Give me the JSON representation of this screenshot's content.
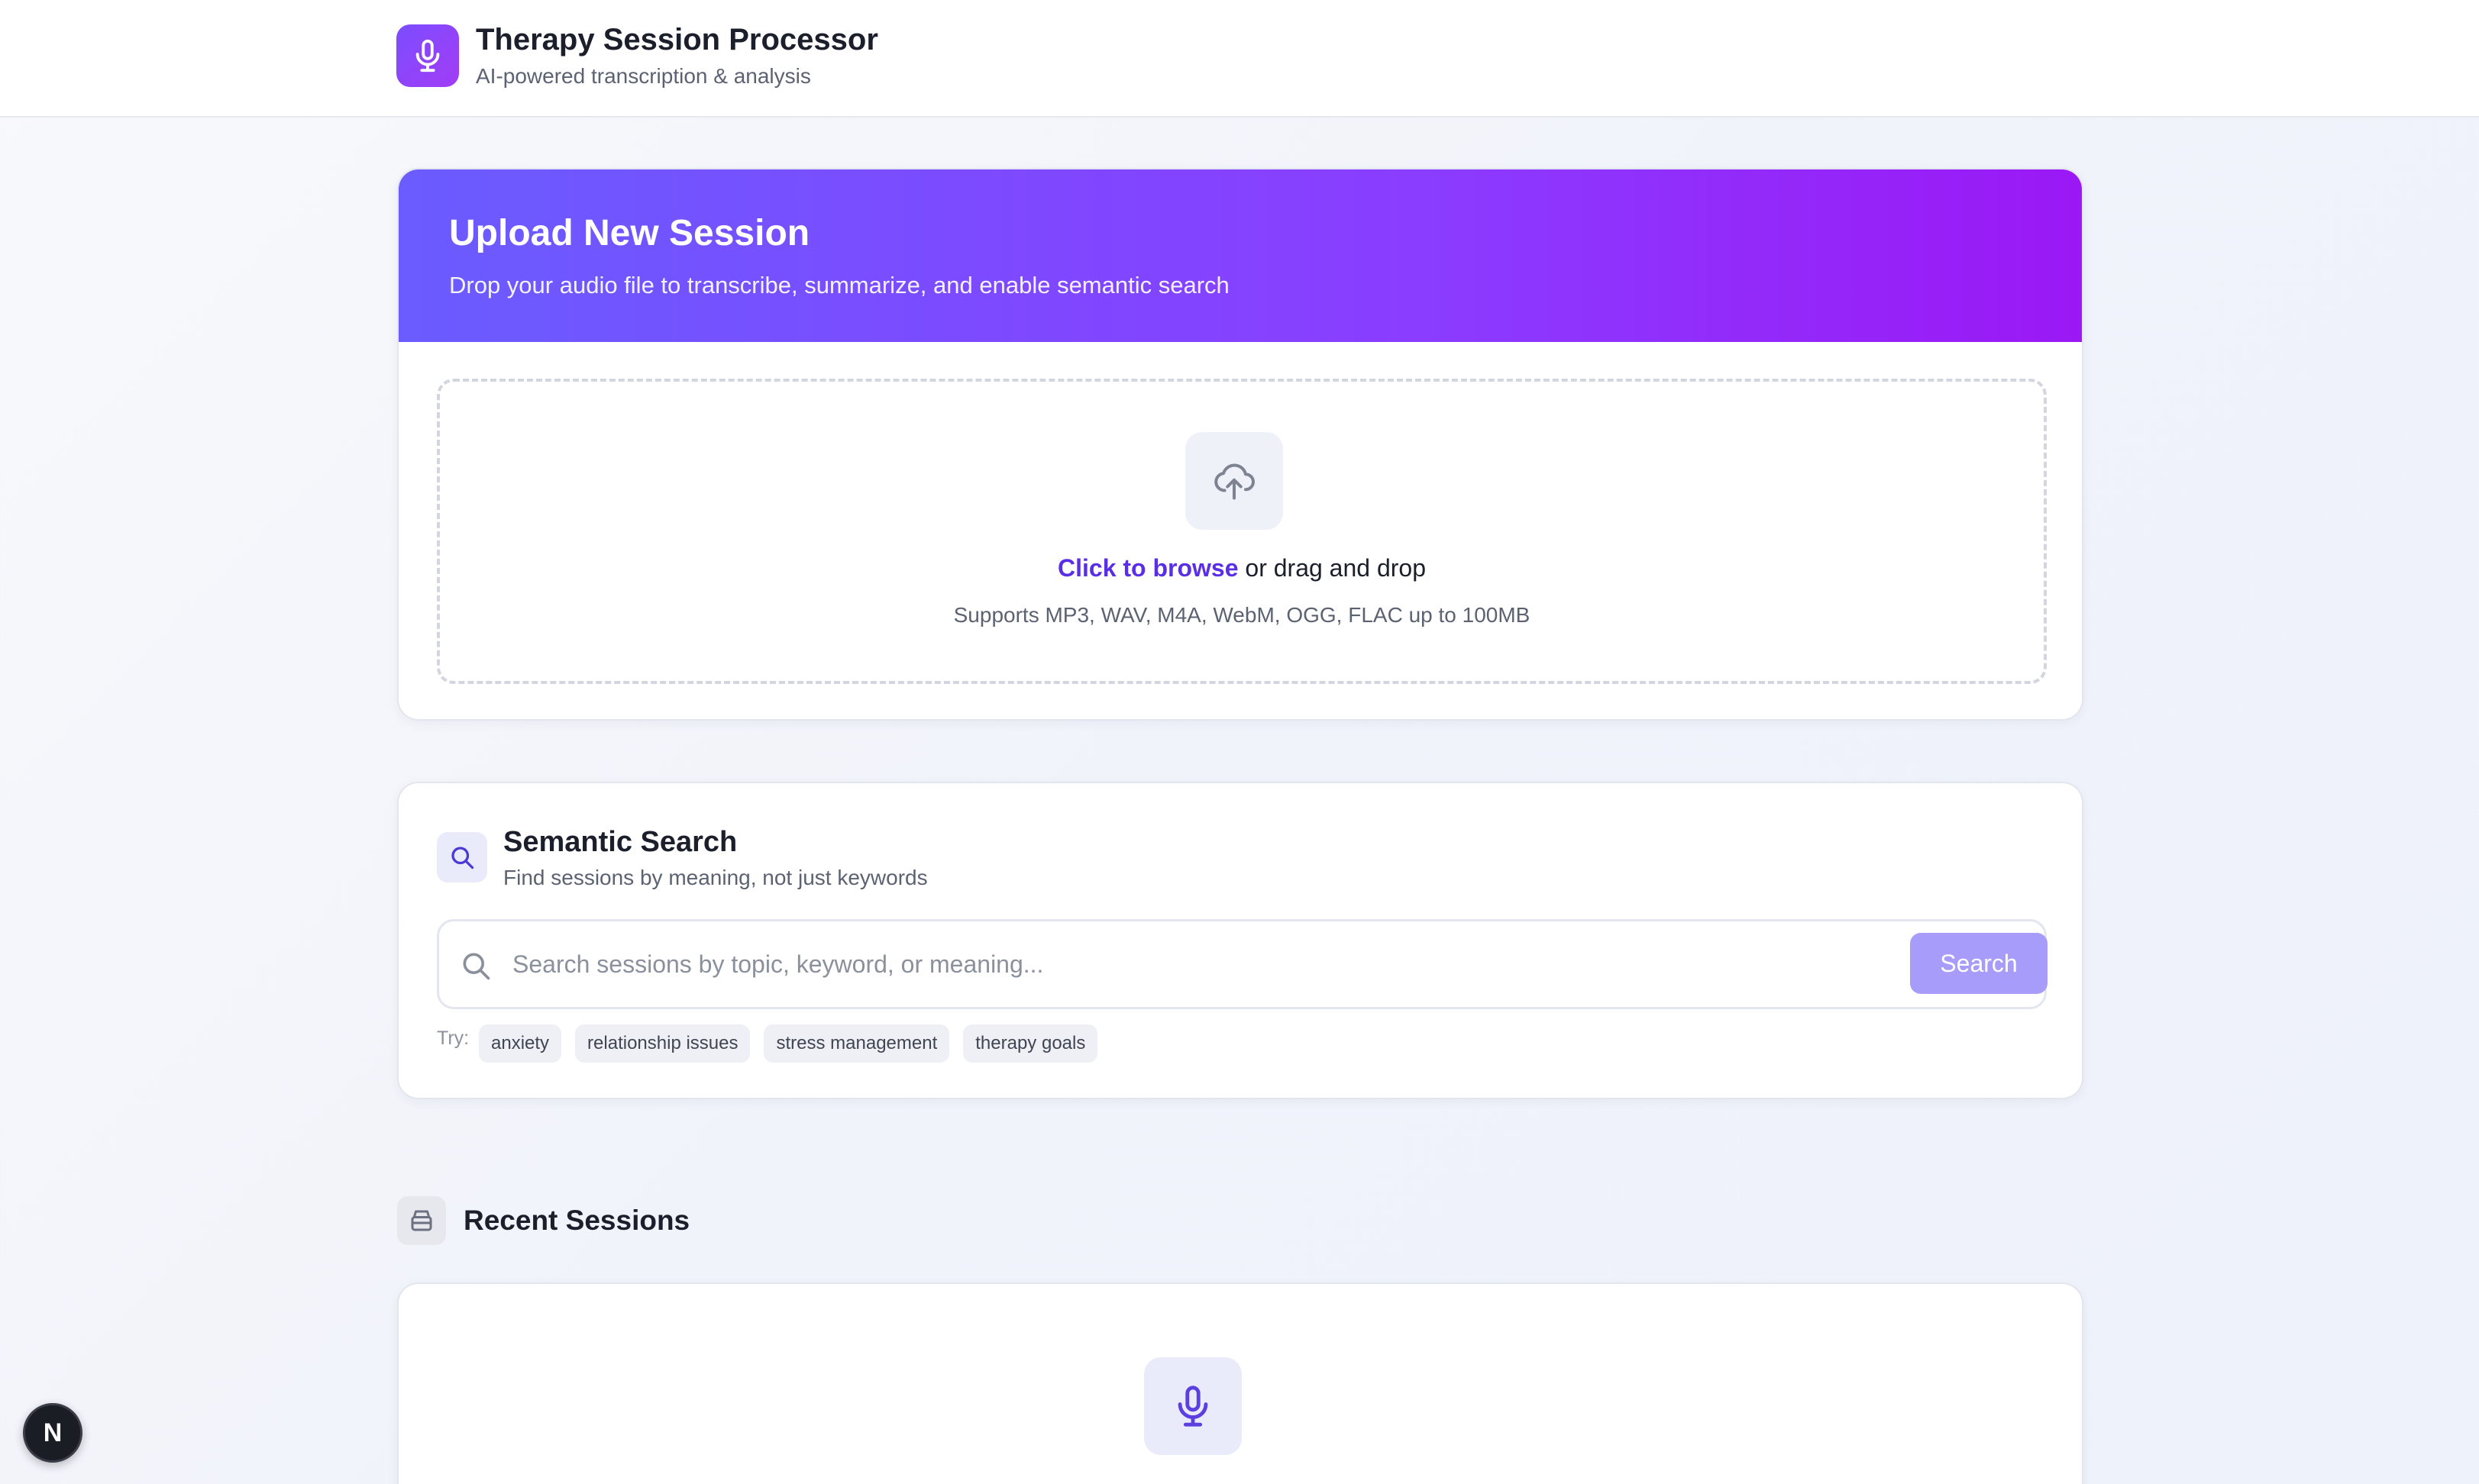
{
  "header": {
    "title": "Therapy Session Processor",
    "subtitle": "AI-powered transcription & analysis",
    "brand_icon": "microphone-icon"
  },
  "upload": {
    "title": "Upload New Session",
    "description": "Drop your audio file to transcribe, summarize, and enable semantic search",
    "browse_link": "Click to browse",
    "browse_suffix": " or drag and drop",
    "supports": "Supports MP3, WAV, M4A, WebM, OGG, FLAC up to 100MB",
    "icon": "cloud-upload-icon"
  },
  "search": {
    "title": "Semantic Search",
    "subtitle": "Find sessions by meaning, not just keywords",
    "placeholder": "Search sessions by topic, keyword, or meaning...",
    "value": "",
    "button_label": "Search",
    "try_label": "Try:",
    "suggestions": [
      "anxiety",
      "relationship issues",
      "stress management",
      "therapy goals"
    ]
  },
  "recent": {
    "title": "Recent Sessions",
    "icon": "archive-icon",
    "empty_icon": "microphone-icon"
  },
  "floating": {
    "label": "N"
  },
  "colors": {
    "accent": "#5a2ee6",
    "banner_start": "#6a5cff",
    "banner_end": "#9b18f5",
    "search_button": "#a89cfb"
  }
}
